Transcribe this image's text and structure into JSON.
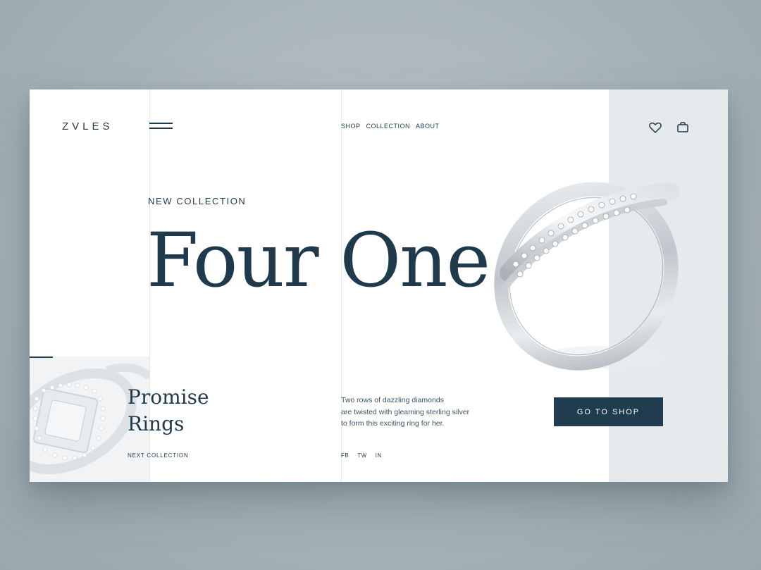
{
  "brand": {
    "logo_text": "ZVLES"
  },
  "header": {
    "menu_icon": "hamburger-icon",
    "nav": [
      "SHOP",
      "COLLECTION",
      "ABOUT"
    ],
    "icons": [
      "heart-icon",
      "shopping-bag-icon"
    ]
  },
  "hero": {
    "eyebrow": "NEW COLLECTION",
    "title": "Four One",
    "image": "diamond-ring"
  },
  "collection": {
    "title_line1": "Promise",
    "title_line2": "Rings",
    "next_label": "NEXT COLLECTION",
    "thumbnail": "princess-cut-ring"
  },
  "product": {
    "description_line1": "Two rows of dazzling diamonds",
    "description_line2": "are twisted with gleaming sterling silver",
    "description_line3": "to form this exciting ring for her.",
    "cta_label": "GO TO SHOP"
  },
  "social": [
    "FB",
    "TW",
    "IN"
  ],
  "colors": {
    "primary": "#1f3a4d",
    "button": "#203c4f",
    "panel": "#e7eaed",
    "page_background": "#a7b3ba"
  }
}
